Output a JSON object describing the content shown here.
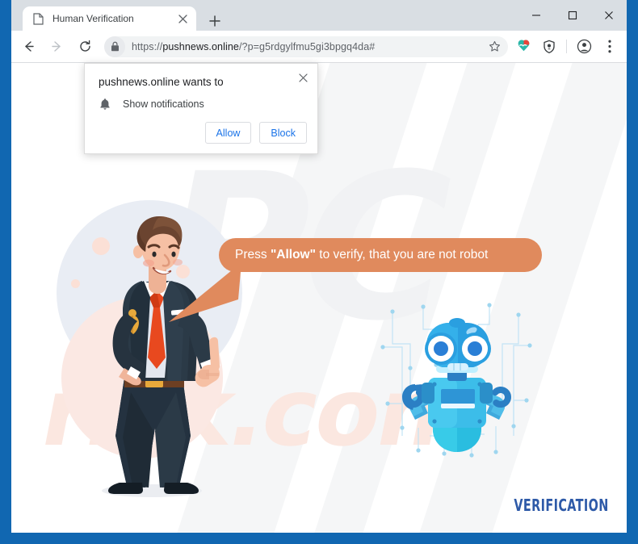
{
  "window": {
    "minimize_label": "Minimize",
    "maximize_label": "Maximize",
    "close_label": "Close"
  },
  "tab": {
    "title": "Human Verification",
    "close_label": "Close tab",
    "new_tab_label": "New tab"
  },
  "toolbar": {
    "back_label": "Back",
    "forward_label": "Forward",
    "reload_label": "Reload",
    "url_prefix": "https://",
    "url_host": "pushnews.online",
    "url_path": "/?p=g5rdgylfmu5gi3bpgq4da#",
    "url_full": "https://pushnews.online/?p=g5rdgylfmu5gi3bpgq4da#",
    "bookmark_label": "Bookmark this tab",
    "extension_label": "Extension",
    "shield_label": "Shield",
    "profile_label": "Profile",
    "menu_label": "Customize and control Google Chrome"
  },
  "dialog": {
    "title": "pushnews.online wants to",
    "permission": "Show notifications",
    "allow_label": "Allow",
    "block_label": "Block",
    "close_label": "Close"
  },
  "page": {
    "bubble_before": "Press ",
    "bubble_emphasis": "\"Allow\"",
    "bubble_after": " to verify, that you are not robot",
    "verification_wordmark": "VERIFICATION",
    "watermark_primary": "PC",
    "watermark_secondary": "risk.com"
  },
  "colors": {
    "window_border": "#1167b1",
    "titlebar": "#d9dee3",
    "bubble": "#e08a5d",
    "link_blue": "#1a73e8",
    "verification_blue": "#2e5aa8",
    "suit_navy": "#26333f",
    "tie_orange": "#e8491f",
    "robot_blue": "#29a3e0"
  }
}
